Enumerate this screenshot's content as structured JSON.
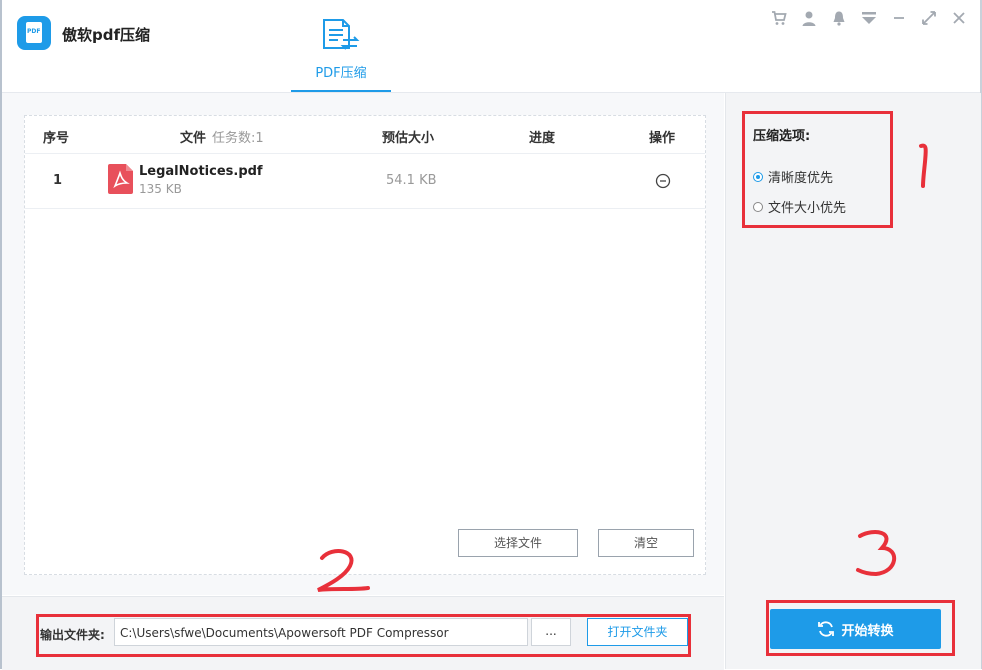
{
  "app": {
    "title": "傲软pdf压缩",
    "logo_text": "PDF"
  },
  "tabs": [
    {
      "label": "PDF压缩",
      "active": true
    }
  ],
  "window_controls": [
    "cart-icon",
    "user-icon",
    "bell-icon",
    "menu-icon",
    "minimize-icon",
    "restore-icon",
    "close-icon"
  ],
  "table": {
    "headers": {
      "index": "序号",
      "file": "文件",
      "task_count": "任务数:1",
      "size": "预估大小",
      "progress": "进度",
      "action": "操作"
    },
    "rows": [
      {
        "index": "1",
        "name": "LegalNotices.pdf",
        "size": "135 KB",
        "estimated": "54.1 KB",
        "progress": ""
      }
    ]
  },
  "buttons": {
    "select_file": "选择文件",
    "clear": "清空",
    "start": "开始转换",
    "browse": "...",
    "open_folder": "打开文件夹"
  },
  "output": {
    "label": "输出文件夹:",
    "path": "C:\\Users\\sfwe\\Documents\\Apowersoft PDF Compressor"
  },
  "options": {
    "title": "压缩选项:",
    "items": [
      {
        "label": "清晰度优先",
        "selected": true
      },
      {
        "label": "文件大小优先",
        "selected": false
      }
    ]
  },
  "colors": {
    "accent": "#1e9be8",
    "annotation": "#e8303a",
    "pdf": "#e8505b"
  }
}
